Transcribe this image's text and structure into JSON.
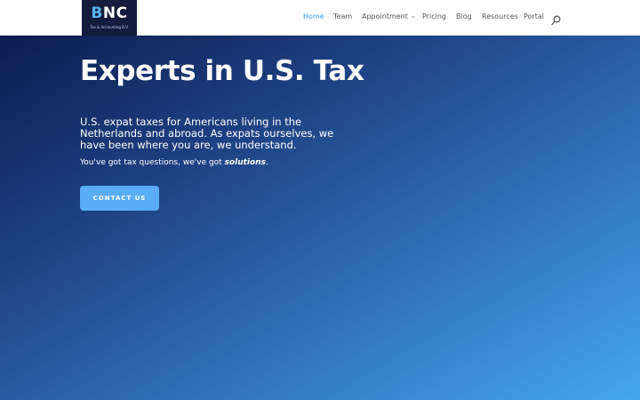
{
  "logo": {
    "text_primary": "NC",
    "text_accent": "B",
    "tagline": "Tax & Accounting B.V."
  },
  "nav": {
    "items": [
      {
        "label": "Home",
        "active": true
      },
      {
        "label": "Team"
      },
      {
        "label": "Appointment",
        "has_dropdown": true
      },
      {
        "label": "Pricing"
      },
      {
        "label": "Blog"
      },
      {
        "label": "Resources"
      },
      {
        "label": "Portal"
      }
    ],
    "search_icon": "search-icon"
  },
  "hero": {
    "title": "Experts in U.S. Tax",
    "description": "U.S. expat taxes for Americans living in the Netherlands and abroad. As expats ourselves, we have been where you are, we understand.",
    "tagline_prefix": "You've got tax questions, we've got ",
    "tagline_emphasis": "solutions",
    "tagline_suffix": ".",
    "cta_label": "CONTACT US"
  },
  "colors": {
    "accent": "#2ea3f2",
    "button": "#58adf4",
    "logo_bg": "#131c3a",
    "hero_gradient_start": "#0c1d4e",
    "hero_gradient_end": "#45a7ee"
  }
}
